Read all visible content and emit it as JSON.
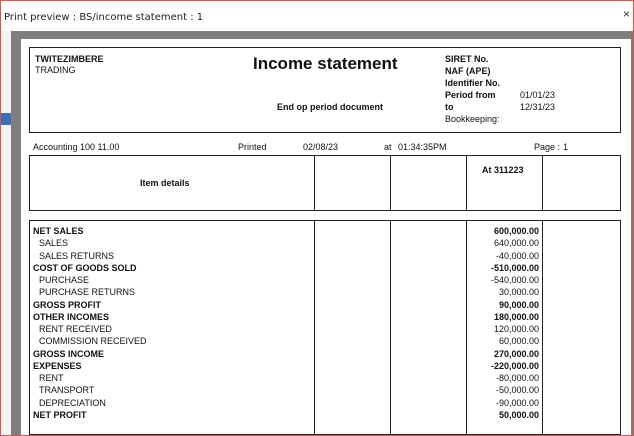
{
  "window": {
    "title": "Print preview : BS/income statement : 1",
    "close_glyph": "×"
  },
  "header": {
    "company_name": "TWITEZIMBERE",
    "company_sub": "TRADING",
    "title": "Income statement",
    "subtitle": "End op period document",
    "siret_label": "SIRET No.",
    "naf_label": "NAF (APE)",
    "identifier_label": "Identifier No.",
    "period_from_label": "Period from",
    "period_from_value": "01/01/23",
    "to_label": "to",
    "to_value": "12/31/23",
    "bookkeeping_label": "Bookkeeping:"
  },
  "info_line": {
    "software": "Accounting 100 11.00",
    "printed_label": "Printed",
    "printed_date": "02/08/23",
    "at_label": "at",
    "printed_time": "01:34:35PM",
    "page_label": "Page :",
    "page_number": "1"
  },
  "table": {
    "item_header": "Item details",
    "amount_header": "At 311223",
    "rows": [
      {
        "label": "NET SALES",
        "amount": "600,000.00",
        "bold": true
      },
      {
        "label": "SALES",
        "amount": "640,000.00",
        "bold": false
      },
      {
        "label": "SALES RETURNS",
        "amount": "-40,000.00",
        "bold": false
      },
      {
        "label": "COST OF GOODS SOLD",
        "amount": "-510,000.00",
        "bold": true
      },
      {
        "label": "PURCHASE",
        "amount": "-540,000.00",
        "bold": false
      },
      {
        "label": "PURCHASE RETURNS",
        "amount": "30,000.00",
        "bold": false
      },
      {
        "label": "GROSS PROFIT",
        "amount": "90,000.00",
        "bold": true
      },
      {
        "label": "OTHER INCOMES",
        "amount": "180,000.00",
        "bold": true
      },
      {
        "label": "RENT RECEIVED",
        "amount": "120,000.00",
        "bold": false
      },
      {
        "label": "COMMISSION RECEIVED",
        "amount": "60,000.00",
        "bold": false
      },
      {
        "label": "GROSS INCOME",
        "amount": "270,000.00",
        "bold": true
      },
      {
        "label": "EXPENSES",
        "amount": "-220,000.00",
        "bold": true
      },
      {
        "label": "RENT",
        "amount": "-80,000.00",
        "bold": false
      },
      {
        "label": "TRANSPORT",
        "amount": "-50,000.00",
        "bold": false
      },
      {
        "label": "DEPRECIATION",
        "amount": "-90,000.00",
        "bold": false
      },
      {
        "label": "NET PROFIT",
        "amount": "50,000.00",
        "bold": true
      }
    ]
  }
}
